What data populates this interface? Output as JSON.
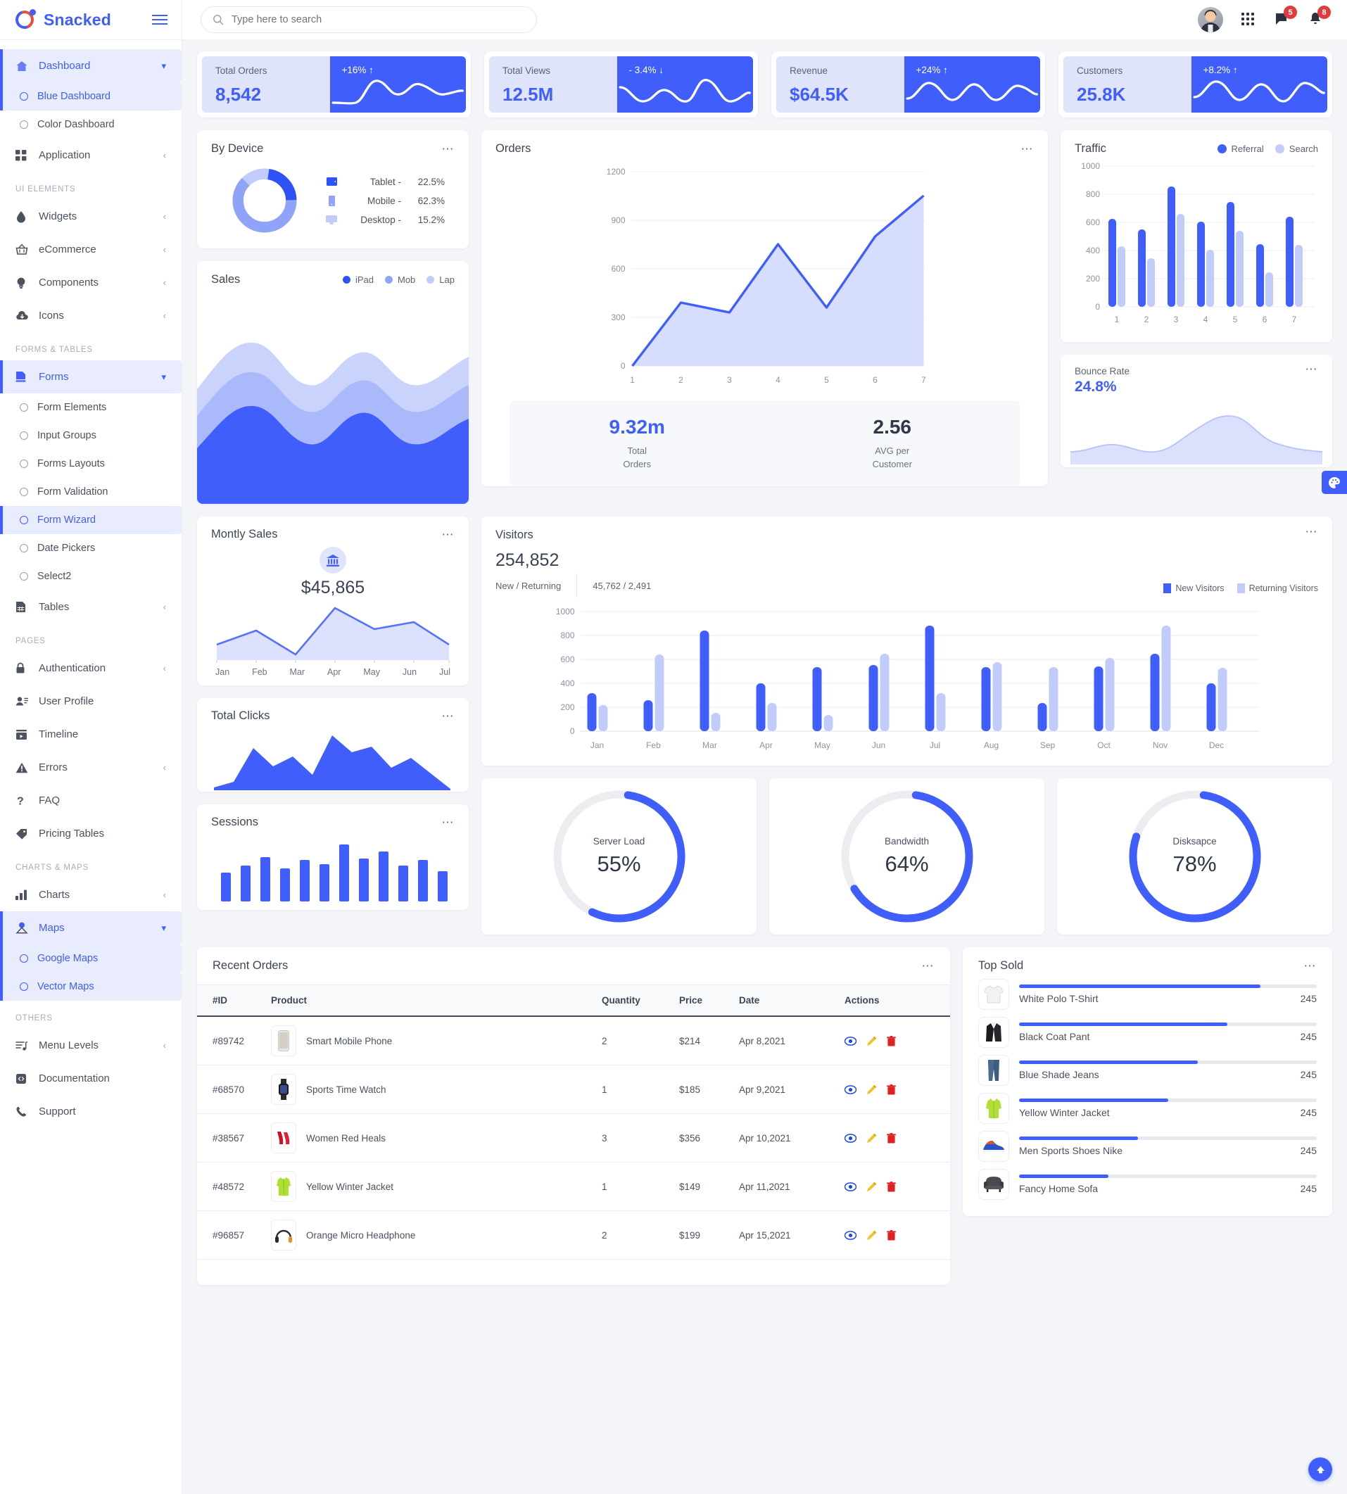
{
  "brand": {
    "name": "Snacked",
    "logo_icon": "snacked-logo-icon",
    "menu_toggle_icon": "hamburger-icon"
  },
  "search": {
    "placeholder": "Type here to search",
    "icon": "search-icon",
    "value": ""
  },
  "topbar": {
    "avatar": "user-avatar",
    "apps_icon": "grid-apps-icon",
    "messages_icon": "message-icon",
    "messages_badge": "5",
    "notifications_icon": "bell-icon",
    "notifications_badge": "8"
  },
  "sidebar": {
    "items": [
      {
        "label": "Dashboard",
        "icon": "home-icon",
        "state": "active-parent",
        "chevron": "chevron-down"
      },
      {
        "label": "Blue Dashboard",
        "icon": "circle-bullet",
        "state": "active-sub"
      },
      {
        "label": "Color Dashboard",
        "icon": "circle-bullet",
        "state": "sub"
      },
      {
        "label": "Application",
        "icon": "grid-icon",
        "state": "normal",
        "chevron": "chevron-left"
      }
    ],
    "section_ui": "UI ELEMENTS",
    "ui_items": [
      {
        "label": "Widgets",
        "icon": "droplet-icon",
        "chevron": "chevron-left"
      },
      {
        "label": "eCommerce",
        "icon": "basket-icon",
        "chevron": "chevron-left"
      },
      {
        "label": "Components",
        "icon": "bulb-icon",
        "chevron": "chevron-left"
      },
      {
        "label": "Icons",
        "icon": "cloud-download-icon",
        "chevron": "chevron-left"
      }
    ],
    "section_forms": "FORMS & TABLES",
    "forms_items": [
      {
        "label": "Forms",
        "icon": "form-icon",
        "state": "active-parent",
        "chevron": "chevron-down"
      },
      {
        "label": "Form Elements",
        "icon": "circle-bullet",
        "state": "sub"
      },
      {
        "label": "Input Groups",
        "icon": "circle-bullet",
        "state": "sub"
      },
      {
        "label": "Forms Layouts",
        "icon": "circle-bullet",
        "state": "sub"
      },
      {
        "label": "Form Validation",
        "icon": "circle-bullet",
        "state": "sub"
      },
      {
        "label": "Form Wizard",
        "icon": "circle-bullet",
        "state": "active-sub"
      },
      {
        "label": "Date Pickers",
        "icon": "circle-bullet",
        "state": "sub"
      },
      {
        "label": "Select2",
        "icon": "circle-bullet",
        "state": "sub"
      },
      {
        "label": "Tables",
        "icon": "table-icon",
        "state": "normal",
        "chevron": "chevron-left"
      }
    ],
    "section_pages": "PAGES",
    "pages_items": [
      {
        "label": "Authentication",
        "icon": "lock-icon",
        "chevron": "chevron-left"
      },
      {
        "label": "User Profile",
        "icon": "user-card-icon"
      },
      {
        "label": "Timeline",
        "icon": "timeline-icon"
      },
      {
        "label": "Errors",
        "icon": "warning-icon",
        "chevron": "chevron-left"
      },
      {
        "label": "FAQ",
        "icon": "question-icon"
      },
      {
        "label": "Pricing Tables",
        "icon": "tag-icon"
      }
    ],
    "section_charts": "CHARTS & MAPS",
    "charts_items": [
      {
        "label": "Charts",
        "icon": "bar-chart-icon",
        "chevron": "chevron-left"
      },
      {
        "label": "Maps",
        "icon": "map-pin-icon",
        "state": "active-parent",
        "chevron": "chevron-down"
      },
      {
        "label": "Google Maps",
        "icon": "circle-bullet",
        "state": "active-sub"
      },
      {
        "label": "Vector Maps",
        "icon": "circle-bullet",
        "state": "active-sub"
      }
    ],
    "section_others": "OTHERS",
    "others_items": [
      {
        "label": "Menu Levels",
        "icon": "menu-levels-icon",
        "chevron": "chevron-left"
      },
      {
        "label": "Documentation",
        "icon": "code-icon"
      },
      {
        "label": "Support",
        "icon": "phone-icon"
      }
    ]
  },
  "kpis": [
    {
      "label": "Total Orders",
      "value": "8,542",
      "delta": "+16% ↑",
      "trend": "up"
    },
    {
      "label": "Total Views",
      "value": "12.5M",
      "delta": "- 3.4% ↓",
      "trend": "down"
    },
    {
      "label": "Revenue",
      "value": "$64.5K",
      "delta": "+24% ↑",
      "trend": "up"
    },
    {
      "label": "Customers",
      "value": "25.8K",
      "delta": "+8.2% ↑",
      "trend": "up"
    }
  ],
  "by_device": {
    "title": "By Device",
    "menu_icon": "more-options-icon",
    "rows": [
      {
        "icon": "tablet-icon",
        "name": "Tablet -",
        "value": "22.5%",
        "color": "#2f52f7"
      },
      {
        "icon": "mobile-icon",
        "name": "Mobile -",
        "value": "62.3%",
        "color": "#8fa3f9"
      },
      {
        "icon": "desktop-icon",
        "name": "Desktop -",
        "value": "15.2%",
        "color": "#c2ccfb"
      }
    ]
  },
  "sales": {
    "title": "Sales",
    "legend": [
      {
        "label": "iPad",
        "color": "#2f52f7"
      },
      {
        "label": "Mob",
        "color": "#8fa3f9"
      },
      {
        "label": "Lap",
        "color": "#c2ccfb"
      }
    ]
  },
  "orders_panel": {
    "title": "Orders",
    "menu_icon": "more-options-icon",
    "stats": [
      {
        "value": "9.32m",
        "label": "Total\nOrders"
      },
      {
        "value": "2.56",
        "label": "AVG per\nCustomer"
      }
    ]
  },
  "traffic_panel": {
    "title": "Traffic"
  },
  "bounce": {
    "title": "Bounce Rate",
    "value": "24.8%",
    "menu_icon": "more-options-icon"
  },
  "monthly_sales": {
    "title": "Montly Sales",
    "icon": "bank-icon",
    "amount": "$45,865",
    "menu_icon": "more-options-icon"
  },
  "total_clicks": {
    "title": "Total Clicks",
    "menu_icon": "more-options-icon"
  },
  "sessions": {
    "title": "Sessions",
    "menu_icon": "more-options-icon"
  },
  "visitors": {
    "title": "Visitors",
    "total": "254,852",
    "ratio_label": "New / Returning",
    "ratio_value": "45,762 / 2,491",
    "menu_icon": "more-options-icon"
  },
  "gauges": [
    {
      "name": "Server Load",
      "value": "55%",
      "pct": 55
    },
    {
      "name": "Bandwidth",
      "value": "64%",
      "pct": 64
    },
    {
      "name": "Disksapce",
      "value": "78%",
      "pct": 78
    }
  ],
  "recent_orders": {
    "title": "Recent Orders",
    "menu_icon": "more-options-icon",
    "columns": [
      "#ID",
      "Product",
      "Quantity",
      "Price",
      "Date",
      "Actions"
    ],
    "rows": [
      {
        "id": "#89742",
        "product": "Smart Mobile Phone",
        "thumb": "phone-thumb",
        "quantity": "2",
        "price": "$214",
        "date": "Apr 8,2021"
      },
      {
        "id": "#68570",
        "product": "Sports Time Watch",
        "thumb": "watch-thumb",
        "quantity": "1",
        "price": "$185",
        "date": "Apr 9,2021"
      },
      {
        "id": "#38567",
        "product": "Women Red Heals",
        "thumb": "heels-thumb",
        "quantity": "3",
        "price": "$356",
        "date": "Apr 10,2021"
      },
      {
        "id": "#48572",
        "product": "Yellow Winter Jacket",
        "thumb": "jacket-thumb",
        "quantity": "1",
        "price": "$149",
        "date": "Apr 11,2021"
      },
      {
        "id": "#96857",
        "product": "Orange Micro Headphone",
        "thumb": "headphone-thumb",
        "quantity": "2",
        "price": "$199",
        "date": "Apr 15,2021"
      }
    ],
    "action_icons": [
      "view-icon",
      "edit-icon",
      "delete-icon"
    ]
  },
  "top_sold": {
    "title": "Top Sold",
    "menu_icon": "more-options-icon",
    "items": [
      {
        "name": "White Polo T-Shirt",
        "count": "245",
        "pct": 81,
        "thumb": "tshirt-thumb"
      },
      {
        "name": "Black Coat Pant",
        "count": "245",
        "pct": 70,
        "thumb": "coat-thumb"
      },
      {
        "name": "Blue Shade Jeans",
        "count": "245",
        "pct": 60,
        "thumb": "jeans-thumb"
      },
      {
        "name": "Yellow Winter Jacket",
        "count": "245",
        "pct": 50,
        "thumb": "jacket-thumb"
      },
      {
        "name": "Men Sports Shoes Nike",
        "count": "245",
        "pct": 40,
        "thumb": "shoes-thumb"
      },
      {
        "name": "Fancy Home Sofa",
        "count": "245",
        "pct": 30,
        "thumb": "sofa-thumb"
      }
    ]
  },
  "floating": {
    "theme_icon": "palette-icon",
    "scroll_top_icon": "arrow-up-icon"
  },
  "colors": {
    "primary": "#3f5efb",
    "primary_light": "#8fa3f9",
    "primary_lighter": "#c2ccfb",
    "danger": "#e13b3b",
    "bg": "#f4f5f9"
  },
  "chart_data": [
    {
      "type": "line",
      "name": "kpi-sparkline-total-orders",
      "values": [
        30,
        35,
        70,
        48,
        66,
        40,
        44
      ],
      "title": "Total Orders",
      "grid": false,
      "ylim": [
        0,
        100
      ]
    },
    {
      "type": "line",
      "name": "kpi-sparkline-total-views",
      "values": [
        62,
        30,
        52,
        34,
        74,
        30,
        55
      ],
      "title": "Total Views",
      "grid": false,
      "ylim": [
        0,
        100
      ]
    },
    {
      "type": "line",
      "name": "kpi-sparkline-revenue",
      "values": [
        38,
        66,
        34,
        62,
        36,
        64,
        46
      ],
      "title": "Revenue",
      "grid": false,
      "ylim": [
        0,
        100
      ]
    },
    {
      "type": "line",
      "name": "kpi-sparkline-customers",
      "values": [
        40,
        70,
        36,
        60,
        34,
        68,
        50
      ],
      "title": "Customers",
      "grid": false,
      "ylim": [
        0,
        100
      ]
    },
    {
      "type": "pie",
      "name": "by-device-donut",
      "title": "By Device",
      "labels": [
        "Tablet",
        "Mobile",
        "Desktop"
      ],
      "values": [
        22.5,
        62.3,
        15.2
      ],
      "colors": [
        "#2f52f7",
        "#8fa3f9",
        "#c2ccfb"
      ]
    },
    {
      "type": "area",
      "name": "sales-stacked-area",
      "title": "Sales",
      "x": [
        0,
        1,
        2,
        3,
        4,
        5,
        6,
        7,
        8
      ],
      "series": [
        {
          "name": "iPad",
          "values": [
            30,
            52,
            34,
            60,
            33,
            58,
            35,
            62,
            40
          ]
        },
        {
          "name": "Mob",
          "values": [
            18,
            24,
            16,
            26,
            15,
            25,
            17,
            26,
            20
          ]
        },
        {
          "name": "Lap",
          "values": [
            14,
            20,
            14,
            22,
            13,
            20,
            14,
            22,
            16
          ]
        }
      ],
      "legend": "top-right",
      "grid": false
    },
    {
      "type": "area",
      "name": "orders-area-chart",
      "title": "Orders",
      "categories": [
        "1",
        "2",
        "3",
        "4",
        "5",
        "6",
        "7"
      ],
      "values": [
        0,
        390,
        330,
        750,
        360,
        800,
        1050
      ],
      "ylim": [
        0,
        1200
      ],
      "yticks": [
        0,
        300,
        600,
        900,
        1200
      ],
      "xlabel": "",
      "ylabel": "",
      "grid": true
    },
    {
      "type": "bar",
      "name": "traffic-bar-chart",
      "title": "Traffic",
      "categories": [
        "1",
        "2",
        "3",
        "4",
        "5",
        "6",
        "7"
      ],
      "series": [
        {
          "name": "Referral",
          "values": [
            625,
            550,
            855,
            605,
            745,
            445,
            640
          ],
          "color": "#3f5efb"
        },
        {
          "name": "Search",
          "values": [
            430,
            345,
            660,
            405,
            540,
            245,
            440
          ],
          "color": "#c2ccfb"
        }
      ],
      "ylim": [
        0,
        1000
      ],
      "yticks": [
        0,
        200,
        400,
        600,
        800,
        1000
      ],
      "legend": "top-right",
      "grid": true
    },
    {
      "type": "area",
      "name": "bounce-rate-area",
      "title": "Bounce Rate",
      "values": [
        22,
        26,
        20,
        30,
        24,
        28,
        54,
        60,
        44,
        30,
        24,
        20
      ],
      "grid": false
    },
    {
      "type": "area",
      "name": "monthly-sales-line",
      "title": "Montly Sales",
      "categories": [
        "Jan",
        "Feb",
        "Mar",
        "Apr",
        "May",
        "Jun",
        "Jul"
      ],
      "values": [
        28,
        50,
        22,
        88,
        62,
        72,
        30
      ],
      "grid": false
    },
    {
      "type": "area",
      "name": "total-clicks-area",
      "title": "Total Clicks",
      "values": [
        4,
        12,
        68,
        42,
        56,
        26,
        96,
        70,
        80,
        46,
        64,
        30,
        6
      ],
      "grid": false
    },
    {
      "type": "bar",
      "name": "sessions-bar-chart",
      "title": "Sessions",
      "values": [
        38,
        50,
        62,
        46,
        58,
        52,
        80,
        60,
        70,
        50,
        58,
        42
      ],
      "grid": false
    },
    {
      "type": "bar",
      "name": "visitors-bar-chart",
      "title": "Visitors",
      "categories": [
        "Jan",
        "Feb",
        "Mar",
        "Apr",
        "May",
        "Jun",
        "Jul",
        "Aug",
        "Sep",
        "Oct",
        "Nov",
        "Dec"
      ],
      "series": [
        {
          "name": "New Visitors",
          "values": [
            320,
            260,
            840,
            400,
            535,
            550,
            885,
            535,
            235,
            540,
            650,
            400
          ],
          "color": "#3f5efb"
        },
        {
          "name": "Returning Visitors",
          "values": [
            220,
            640,
            150,
            235,
            135,
            650,
            320,
            575,
            535,
            615,
            885,
            530
          ],
          "color": "#c2ccfb"
        }
      ],
      "ylim": [
        0,
        1000
      ],
      "yticks": [
        0,
        200,
        400,
        600,
        800,
        1000
      ],
      "legend": "top-right",
      "grid": true
    },
    {
      "type": "pie",
      "name": "gauge-server-load",
      "title": "Server Load",
      "values": [
        55,
        45
      ],
      "labels": [
        "used",
        "free"
      ]
    },
    {
      "type": "pie",
      "name": "gauge-bandwidth",
      "title": "Bandwidth",
      "values": [
        64,
        36
      ],
      "labels": [
        "used",
        "free"
      ]
    },
    {
      "type": "pie",
      "name": "gauge-diskspace",
      "title": "Disksapce",
      "values": [
        78,
        22
      ],
      "labels": [
        "used",
        "free"
      ]
    },
    {
      "type": "bar",
      "name": "top-sold-progress",
      "title": "Top Sold",
      "categories": [
        "White Polo T-Shirt",
        "Black Coat Pant",
        "Blue Shade Jeans",
        "Yellow Winter Jacket",
        "Men Sports Shoes Nike",
        "Fancy Home Sofa"
      ],
      "values": [
        81,
        70,
        60,
        50,
        40,
        30
      ],
      "labels": [
        "245",
        "245",
        "245",
        "245",
        "245",
        "245"
      ]
    }
  ]
}
